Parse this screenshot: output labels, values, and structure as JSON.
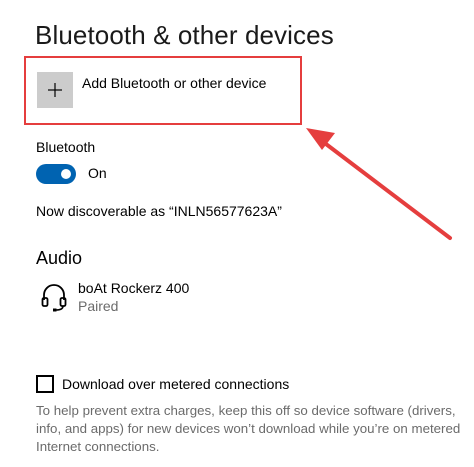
{
  "page": {
    "title": "Bluetooth & other devices"
  },
  "add_device": {
    "label": "Add Bluetooth or other device",
    "icon": "plus-icon"
  },
  "bluetooth": {
    "label": "Bluetooth",
    "toggle_state": "On",
    "discoverable_text": "Now discoverable as “INLN56577623A”"
  },
  "audio": {
    "heading": "Audio",
    "devices": [
      {
        "name": "boAt Rockerz 400",
        "status": "Paired",
        "icon": "headset-icon"
      }
    ]
  },
  "metered": {
    "checkbox_label": "Download over metered connections",
    "checked": false,
    "help_text": "To help prevent extra charges, keep this off so device software (drivers, info, and apps) for new devices won’t download while you’re on metered Internet connections."
  },
  "colors": {
    "accent": "#0063b1",
    "annotation": "#e53e3e",
    "tile": "#cccccc",
    "secondary_text": "#6b6b6b"
  }
}
